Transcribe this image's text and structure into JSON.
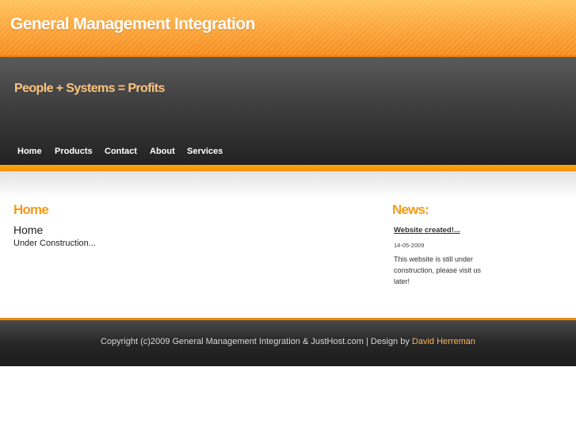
{
  "header": {
    "site_title": "General Management Integration",
    "tagline": "People + Systems = Profits"
  },
  "nav": {
    "items": [
      "Home",
      "Products",
      "Contact",
      "About",
      "Services"
    ]
  },
  "main": {
    "heading": "Home",
    "subheading": "Home",
    "text": "Under Construction..."
  },
  "news": {
    "heading": "News:",
    "item_title": "Website created!...",
    "item_date": "14-05-2009",
    "item_body": "This website is still under construction, please visit us later!"
  },
  "footer": {
    "copyright": "Copyright (c)2009 General Management Integration & JustHost.com | Design by",
    "designer": "David Herreman"
  },
  "colors": {
    "accent_orange": "#f59a1a",
    "header_dark": "#3e3e3e",
    "tagline_color": "#fcc47e"
  }
}
